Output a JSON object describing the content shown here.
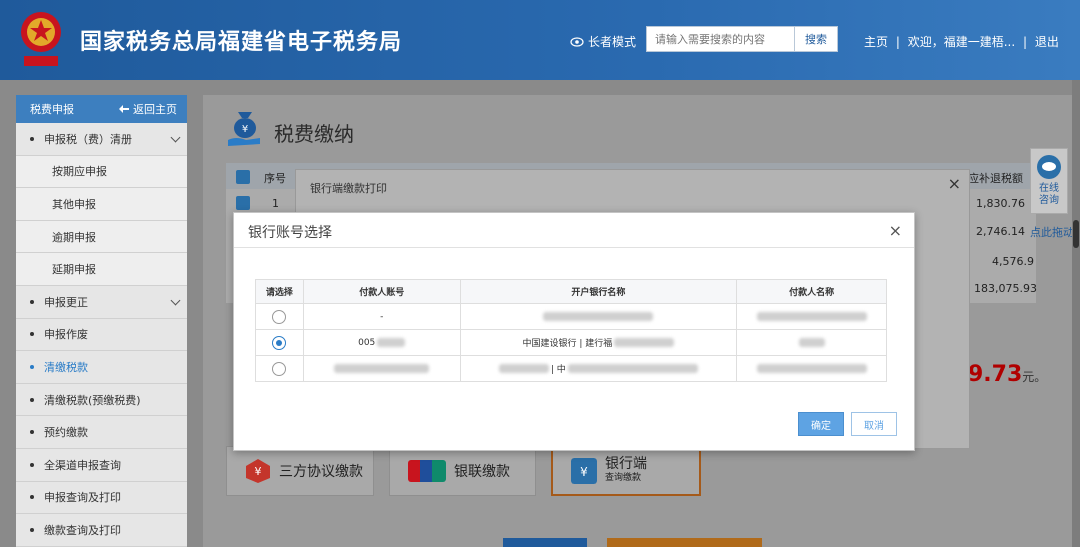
{
  "header": {
    "title": "国家税务总局福建省电子税务局",
    "elder_mode": "长者模式",
    "search_placeholder": "请输入需要搜索的内容",
    "search_button": "搜索",
    "links": [
      "主页",
      "欢迎，福建一建梧...",
      "退出"
    ]
  },
  "sidebar": {
    "header": "税费申报",
    "back": "返回主页",
    "items": [
      {
        "label": "申报税（费）清册",
        "expandable": true
      },
      {
        "label": "按期应申报",
        "sub": true
      },
      {
        "label": "其他申报",
        "sub": true
      },
      {
        "label": "逾期申报",
        "sub": true
      },
      {
        "label": "延期申报",
        "sub": true
      },
      {
        "label": "申报更正",
        "expandable": true
      },
      {
        "label": "申报作废"
      },
      {
        "label": "清缴税款",
        "active": true
      },
      {
        "label": "清缴税款(预缴税费)"
      },
      {
        "label": "预约缴款"
      },
      {
        "label": "全渠道申报查询"
      },
      {
        "label": "申报查询及打印"
      },
      {
        "label": "缴款查询及打印"
      }
    ]
  },
  "main": {
    "page_title": "税费缴纳",
    "table_col_seq": "序号",
    "table_col_refund": "应补退税额",
    "row_seq_1": "1",
    "amounts": [
      "1,830.76",
      "2,746.14",
      "4,576.9",
      "183,075.93"
    ],
    "total_amount": "9.73",
    "total_unit": "元。",
    "payment_options": [
      {
        "label": "三方协议缴款",
        "icon": "tripartite-icon"
      },
      {
        "label": "银联缴款",
        "icon": "unionpay-icon"
      },
      {
        "label": "银行端",
        "sublabel": "查询缴款",
        "icon": "bank-icon",
        "selected": true
      }
    ]
  },
  "float": {
    "consult_line1": "在线",
    "consult_line2": "咨询",
    "drag": "点此拖动"
  },
  "back_dialog": {
    "title": "银行端缴款打印"
  },
  "modal": {
    "title": "银行账号选择",
    "columns": [
      "请选择",
      "付款人账号",
      "开户银行名称",
      "付款人名称"
    ],
    "rows": [
      {
        "selected": false,
        "account": "-",
        "bank": "",
        "payer": ""
      },
      {
        "selected": true,
        "account": "005",
        "bank": "中国建设银行 | 建行福",
        "payer": ""
      },
      {
        "selected": false,
        "account": "",
        "bank": "| 中",
        "payer": ""
      }
    ],
    "confirm": "确定",
    "cancel": "取消"
  },
  "colors": {
    "header_blue": "#2a6ab0",
    "sidebar_head": "#3d7fbf",
    "accent_blue": "#2a7cc7",
    "confirm_btn": "#5ea3e3",
    "amount_red": "#b00000"
  }
}
